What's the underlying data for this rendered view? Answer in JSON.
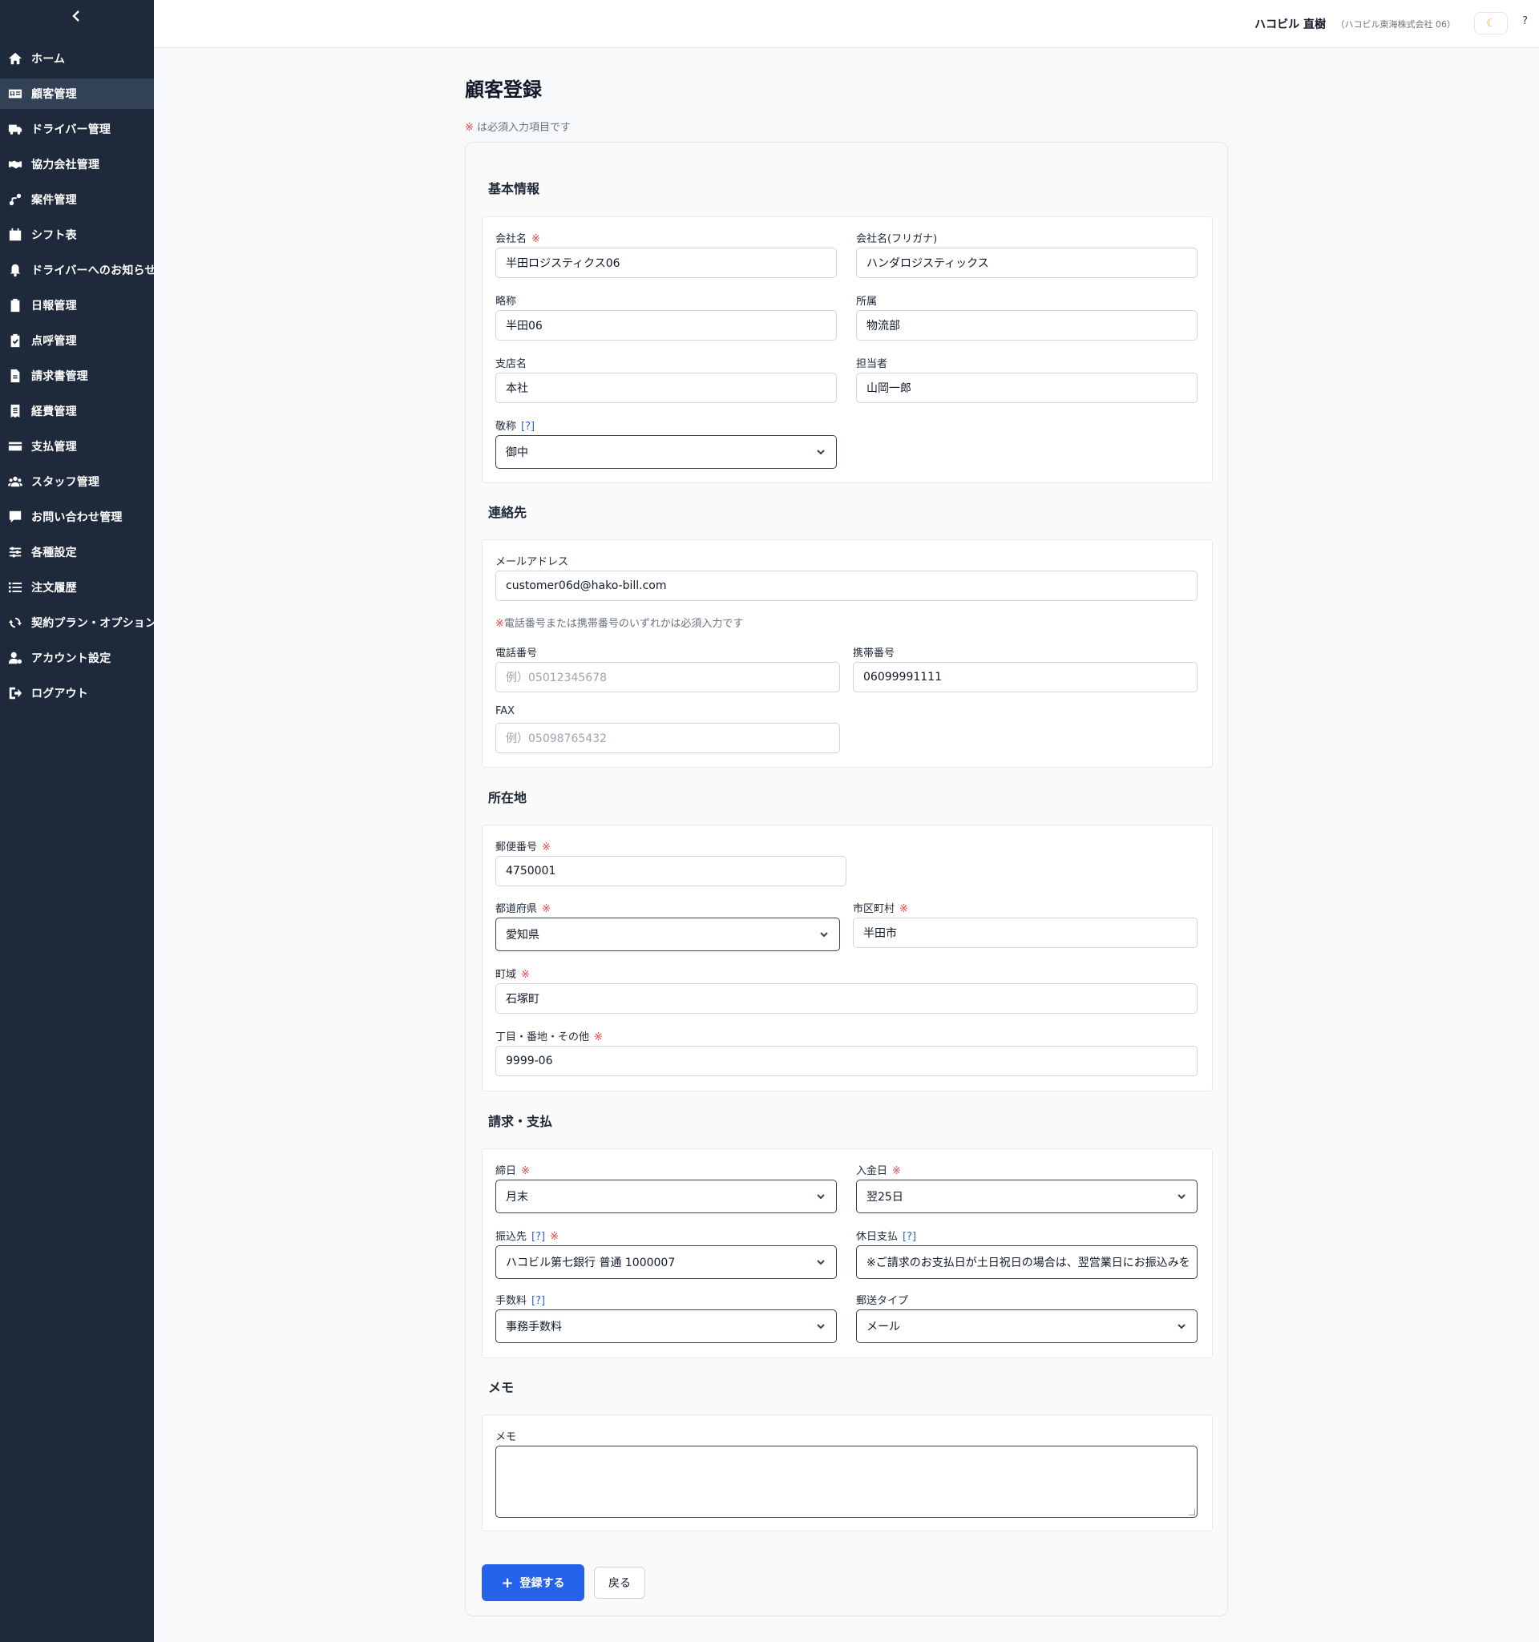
{
  "sidebar": {
    "collapse_icon": "chevron-left-icon",
    "items": [
      {
        "label": "ホーム",
        "icon": "home-icon"
      },
      {
        "label": "顧客管理",
        "icon": "id-card-icon",
        "active": true
      },
      {
        "label": "ドライバー管理",
        "icon": "truck-icon"
      },
      {
        "label": "協力会社管理",
        "icon": "handshake-icon"
      },
      {
        "label": "案件管理",
        "icon": "route-icon"
      },
      {
        "label": "シフト表",
        "icon": "calendar-icon"
      },
      {
        "label": "ドライバーへのお知らせ",
        "icon": "bell-icon"
      },
      {
        "label": "日報管理",
        "icon": "clipboard-icon"
      },
      {
        "label": "点呼管理",
        "icon": "clipboard-check-icon"
      },
      {
        "label": "請求書管理",
        "icon": "document-icon"
      },
      {
        "label": "経費管理",
        "icon": "receipt-icon"
      },
      {
        "label": "支払管理",
        "icon": "credit-card-icon"
      },
      {
        "label": "スタッフ管理",
        "icon": "users-icon"
      },
      {
        "label": "お問い合わせ管理",
        "icon": "chat-icon"
      },
      {
        "label": "各種設定",
        "icon": "sliders-icon"
      },
      {
        "label": "注文履歴",
        "icon": "list-icon"
      },
      {
        "label": "契約プラン・オプション",
        "icon": "refresh-icon"
      },
      {
        "label": "アカウント設定",
        "icon": "user-gear-icon"
      },
      {
        "label": "ログアウト",
        "icon": "logout-icon"
      }
    ]
  },
  "header": {
    "user_name": "ハコビル 直樹",
    "company": "（ハコビル東海株式会社 06）",
    "theme_icon": "moon-icon",
    "help_label": "?"
  },
  "page": {
    "title": "顧客登録",
    "required_mark": "※",
    "required_note": " は必須入力項目です"
  },
  "sections": {
    "basic": {
      "title": "基本情報",
      "company_name": {
        "label": "会社名",
        "value": "半田ロジスティクス06"
      },
      "company_kana": {
        "label": "会社名(フリガナ)",
        "value": "ハンダロジスティックス"
      },
      "short_name": {
        "label": "略称",
        "value": "半田06"
      },
      "department": {
        "label": "所属",
        "value": "物流部"
      },
      "branch": {
        "label": "支店名",
        "value": "本社"
      },
      "contact_person": {
        "label": "担当者",
        "value": "山岡一郎"
      },
      "honorific": {
        "label": "敬称",
        "help": "[?]",
        "value": "御中"
      }
    },
    "contact": {
      "title": "連絡先",
      "email": {
        "label": "メールアドレス",
        "value": "customer06d@hako-bill.com"
      },
      "phone_note": "電話番号または携帯番号のいずれかは必須入力です",
      "phone": {
        "label": "電話番号",
        "placeholder": "例）05012345678"
      },
      "mobile": {
        "label": "携帯番号",
        "value": "06099991111"
      },
      "fax": {
        "label": "FAX",
        "placeholder": "例）05098765432"
      }
    },
    "address": {
      "title": "所在地",
      "postal": {
        "label": "郵便番号",
        "value": "4750001"
      },
      "prefecture": {
        "label": "都道府県",
        "value": "愛知県"
      },
      "city": {
        "label": "市区町村",
        "value": "半田市"
      },
      "town": {
        "label": "町域",
        "value": "石塚町"
      },
      "street": {
        "label": "丁目・番地・その他",
        "value": "9999-06"
      }
    },
    "billing": {
      "title": "請求・支払",
      "closing_day": {
        "label": "締日",
        "value": "月末"
      },
      "payment_day": {
        "label": "入金日",
        "value": "翌25日"
      },
      "bank": {
        "label": "振込先",
        "help": "[?]",
        "value": "ハコビル第七銀行 普通 1000007"
      },
      "holiday_payment": {
        "label": "休日支払",
        "help": "[?]",
        "value": "※ご請求のお支払日が土日祝日の場合は、翌営業日にお振込みを"
      },
      "fee": {
        "label": "手数料",
        "help": "[?]",
        "value": "事務手数料"
      },
      "mail_type": {
        "label": "郵送タイプ",
        "value": "メール"
      }
    },
    "memo": {
      "title": "メモ",
      "label": "メモ",
      "value": ""
    }
  },
  "actions": {
    "submit_label": "登録する",
    "back_label": "戻る"
  }
}
